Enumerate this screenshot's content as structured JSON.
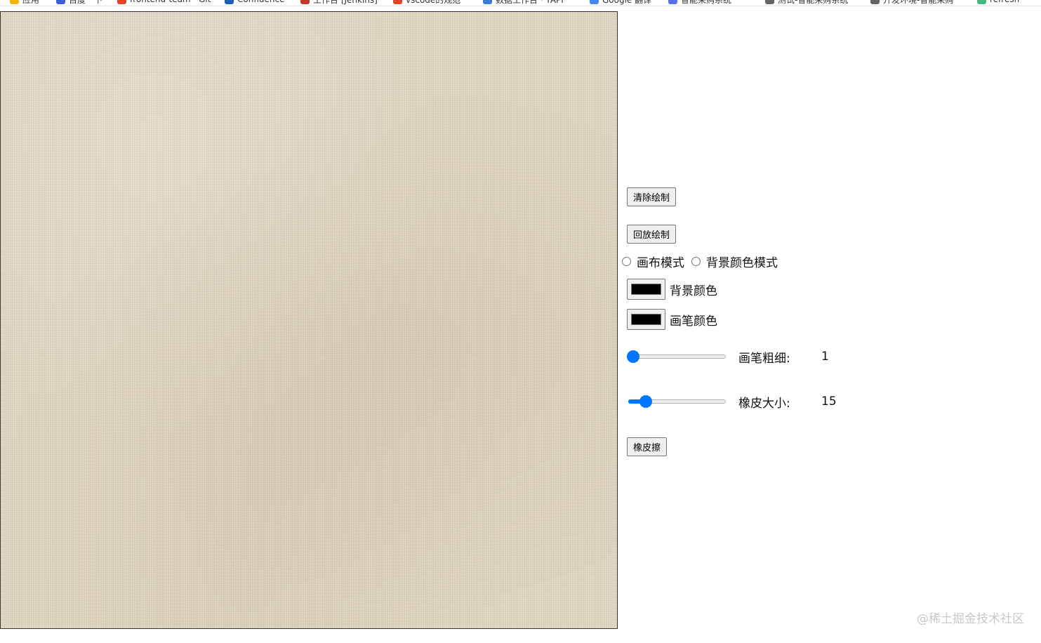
{
  "bookmarks": [
    {
      "label": "应用",
      "icon": "apps-grid-icon",
      "color": "#f4b400"
    },
    {
      "label": "百度一下",
      "icon": "baidu-icon",
      "color": "#3b5fd9"
    },
    {
      "label": "frontend-team · Git",
      "icon": "gitlab-icon",
      "color": "#e24329"
    },
    {
      "label": "Confluence",
      "icon": "confluence-icon",
      "color": "#1f5fb3"
    },
    {
      "label": "工作台 [Jenkins]",
      "icon": "jenkins-icon",
      "color": "#c0392b"
    },
    {
      "label": "vscode的规范",
      "icon": "gitlab-icon",
      "color": "#e24329"
    },
    {
      "label": "数据工作台 · YAPI",
      "icon": "yapi-icon",
      "color": "#3a7bd5"
    },
    {
      "label": "Google 翻译",
      "icon": "translate-icon",
      "color": "#4285f4"
    },
    {
      "label": "智能采购系统",
      "icon": "system-icon",
      "color": "#5a6ff0"
    },
    {
      "label": "测试-智能采购系统",
      "icon": "globe-icon",
      "color": "#666666"
    },
    {
      "label": "开发环境-智能采购",
      "icon": "globe-icon",
      "color": "#666666"
    },
    {
      "label": "refresh",
      "icon": "vue-icon",
      "color": "#42b883"
    }
  ],
  "controls": {
    "clear_label": "清除绘制",
    "replay_label": "回放绘制",
    "radio_canvas_label": "画布模式",
    "radio_bg_label": "背景颜色模式",
    "bg_color_label": "背景颜色",
    "bg_color_value": "#000000",
    "pen_color_label": "画笔颜色",
    "pen_color_value": "#000000",
    "pen_width_label": "画笔粗细:",
    "pen_width_value": "1",
    "pen_width_fraction": 0.0,
    "eraser_size_label": "橡皮大小:",
    "eraser_size_value": "15",
    "eraser_size_fraction": 0.14,
    "eraser_label": "橡皮擦",
    "slider_color": "#0075ff"
  },
  "canvas": {
    "background": "linen-texture",
    "base_color": "#e3d9c1"
  },
  "watermark": "@稀土掘金技术社区"
}
